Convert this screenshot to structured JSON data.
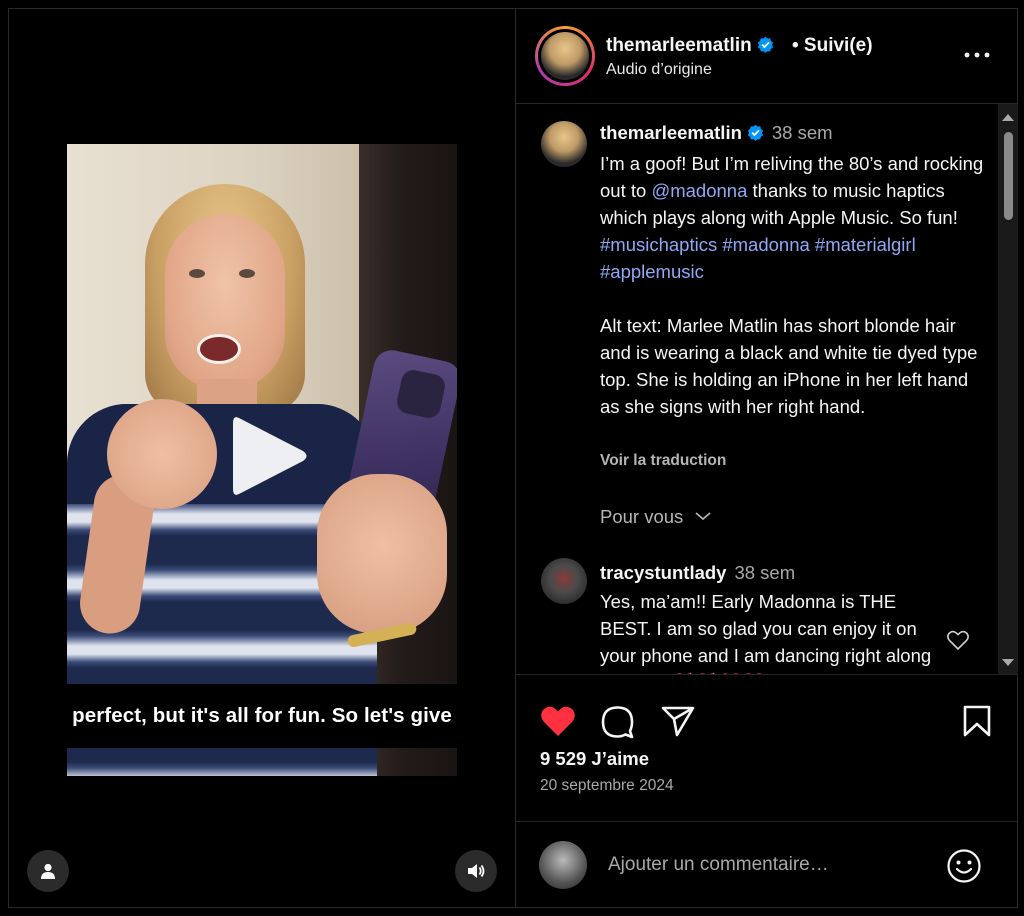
{
  "video": {
    "subtitle": "perfect, but it's all for fun. So let's give",
    "play_icon": "play-icon",
    "user_icon": "user-icon",
    "sound_icon": "speaker-icon"
  },
  "header": {
    "username": "themarleematlin",
    "follow_status": "• Suivi(e)",
    "audio_label": "Audio d’origine",
    "more_icon": "more-icon"
  },
  "caption": {
    "username": "themarleematlin",
    "time": "38 sem",
    "text_1": "I’m a goof! But I’m reliving the 80’s and rocking out to ",
    "mention": "@madonna",
    "text_2": " thanks to music haptics which plays along with Apple Music. So fun! ",
    "hashtags": "#musichaptics #madonna #materialgirl #applemusic",
    "alt_text": "Alt text: Marlee Matlin has short blonde hair and is wearing a black and white tie dyed type top. She is holding an iPhone in her left hand as she signs with her right hand.",
    "translate": "Voir la traduction"
  },
  "filter": {
    "label": "Pour vous"
  },
  "comments": [
    {
      "username": "tracystuntlady",
      "time": "38 sem",
      "text": "Yes, ma’am!! Early Madonna is THE BEST. I am so glad you can enjoy it on your phone and I am dancing right along with you 💖💖❤️💝"
    }
  ],
  "actions": {
    "likes": "9 529 J’aime",
    "date": "20 septembre 2024"
  },
  "compose": {
    "placeholder": "Ajouter un commentaire…"
  },
  "colors": {
    "accent_link": "#8ea9f5",
    "like_red": "#ff3040",
    "verified_blue": "#0095f6"
  }
}
